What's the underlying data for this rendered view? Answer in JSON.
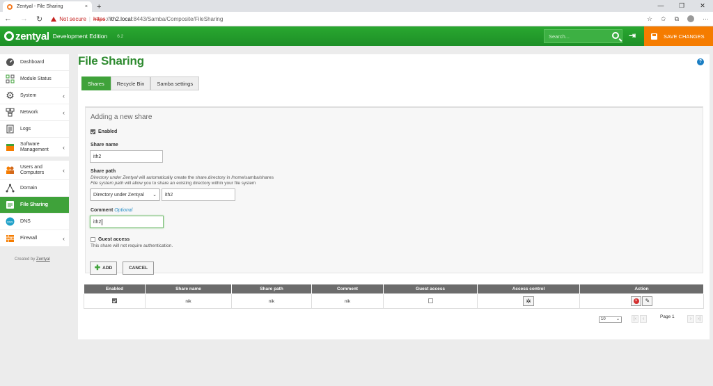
{
  "browser": {
    "tab_title": "Zentyal - File Sharing",
    "tab_close": "×",
    "new_tab": "+",
    "win_min": "—",
    "win_max": "❐",
    "win_close": "✕",
    "back": "←",
    "forward": "→",
    "reload": "↻",
    "not_secure": "Not secure",
    "separator": "|",
    "url_protocol": "https",
    "url_scheme_sep": "://",
    "url_host": "ith2.local",
    "url_path": ":8443/Samba/Composite/FileSharing",
    "star": "☆",
    "favorites": "✩",
    "collections": "⧉",
    "more": "···"
  },
  "header": {
    "logo": "zentyal",
    "edition": "Development Edition",
    "version": "6.2",
    "search_placeholder": "Search...",
    "logout_icon": "⇥",
    "save_changes": "SAVE CHANGES"
  },
  "sidebar": {
    "items": [
      {
        "label": "Dashboard"
      },
      {
        "label": "Module Status"
      },
      {
        "label": "System"
      },
      {
        "label": "Network"
      },
      {
        "label": "Logs"
      },
      {
        "label": "Software Management"
      },
      {
        "label": "Users and Computers"
      },
      {
        "label": "Domain"
      },
      {
        "label": "File Sharing"
      },
      {
        "label": "DNS"
      },
      {
        "label": "Firewall"
      }
    ],
    "chevron": "‹",
    "created_by": "Created by",
    "created_link": "Zentyal"
  },
  "main": {
    "title": "File Sharing",
    "help": "?",
    "tabs": [
      {
        "label": "Shares"
      },
      {
        "label": "Recycle Bin"
      },
      {
        "label": "Samba settings"
      }
    ],
    "form": {
      "title": "Adding a new share",
      "enabled_label": "Enabled",
      "share_name_label": "Share name",
      "share_name_value": "ith2",
      "share_path_label": "Share path",
      "hint1_em": "Directory under Zentyal",
      "hint1_rest": " will automatically create the share.directory in /home/samba/shares",
      "hint2_em": "File system path",
      "hint2_rest": " will allow you to share an existing directory within your file system",
      "path_type": "Directory under Zentyal",
      "path_value": "ith2",
      "comment_label": "Comment",
      "optional": "Optional",
      "comment_value": "ith2",
      "guest_label": "Guest access",
      "guest_hint": "This share will not require authentication.",
      "add_button": "ADD",
      "add_icon": "✚",
      "cancel_button": "CANCEL"
    },
    "table": {
      "headers": [
        "Enabled",
        "Share name",
        "Share path",
        "Comment",
        "Guest access",
        "Access control",
        "Action"
      ],
      "rows": [
        {
          "enabled": true,
          "share_name": "nik",
          "share_path": "nik",
          "comment": "nik",
          "guest": false
        }
      ],
      "gear_icon": "✲",
      "delete_icon": "×",
      "edit_icon": "✎"
    },
    "pager": {
      "page_size": "10",
      "first": "|‹",
      "prev": "‹",
      "page_label": "Page 1",
      "next": "›",
      "last": "›|"
    }
  }
}
